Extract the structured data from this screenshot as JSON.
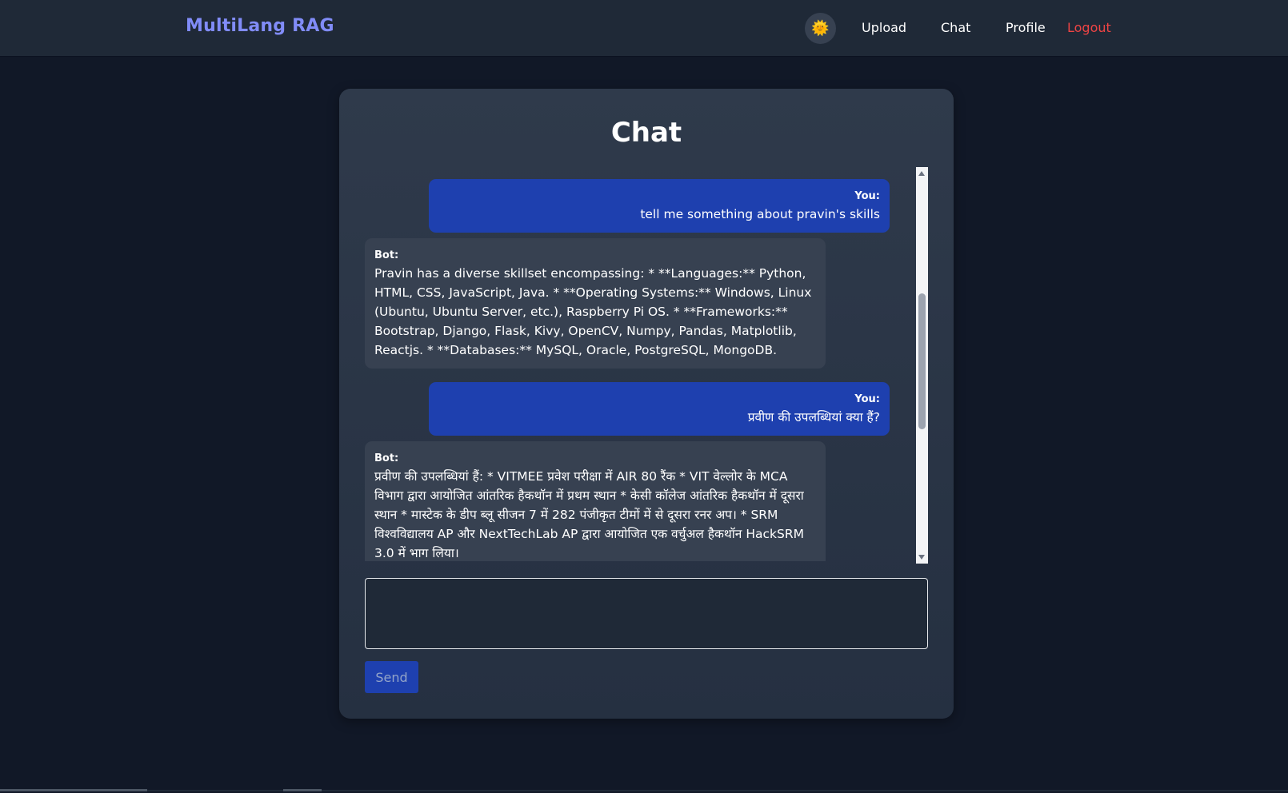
{
  "navbar": {
    "brand": "MultiLang RAG",
    "theme_icon": "sun-icon",
    "links": {
      "upload": "Upload",
      "chat": "Chat",
      "profile": "Profile",
      "logout": "Logout"
    },
    "logout_color": "#ef4444",
    "brand_color": "#818cf8"
  },
  "chat": {
    "title": "Chat",
    "messages": [
      {
        "sender": "You:",
        "role": "user",
        "text": "tell me something about pravin's skills"
      },
      {
        "sender": "Bot:",
        "role": "bot",
        "text": "Pravin has a diverse skillset encompassing: * **Languages:** Python, HTML, CSS, JavaScript, Java. * **Operating Systems:** Windows, Linux (Ubuntu, Ubuntu Server, etc.), Raspberry Pi OS. * **Frameworks:** Bootstrap, Django, Flask, Kivy, OpenCV, Numpy, Pandas, Matplotlib, Reactjs. * **Databases:** MySQL, Oracle, PostgreSQL, MongoDB."
      },
      {
        "sender": "You:",
        "role": "user",
        "text": "प्रवीण की उपलब्धियां क्या हैं?"
      },
      {
        "sender": "Bot:",
        "role": "bot",
        "text": "प्रवीण की उपलब्धियां हैं: * VITMEE प्रवेश परीक्षा में AIR 80 रैंक * VIT वेल्लोर के MCA विभाग द्वारा आयोजित आंतरिक हैकथॉन में प्रथम स्थान * केसी कॉलेज आंतरिक हैकथॉन में दूसरा स्थान * मास्टेक के डीप ब्लू सीजन 7 में 282 पंजीकृत टीमों में से दूसरा रनर अप। * SRM विश्वविद्यालय AP और NextTechLab AP द्वारा आयोजित एक वर्चुअल हैकथॉन HackSRM 3.0 में भाग लिया।"
      }
    ],
    "input": {
      "value": "",
      "placeholder": ""
    },
    "send_label": "Send",
    "user_bubble_color": "#1e40af",
    "bot_bubble_color": "#374151"
  }
}
